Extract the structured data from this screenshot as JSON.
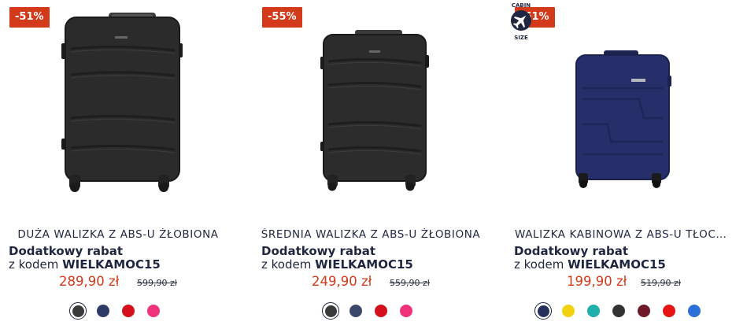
{
  "products": [
    {
      "badge": "-51%",
      "title": "DUŻA WALIZKA Z ABS-U ŻŁOBIONA",
      "promo_title": "Dodatkowy rabat",
      "promo_prefix": "z kodem",
      "promo_code": "WIELKAMOC15",
      "price": "289,90 zł",
      "old_price": "599,90 zł",
      "image": "black-large-hardshell-suitcase",
      "swatches": [
        "#3a3a3a",
        "#2e3a66",
        "#d4101a",
        "#f0327a"
      ]
    },
    {
      "badge": "-55%",
      "title": "ŚREDNIA WALIZKA Z ABS-U ŻŁOBIONA",
      "promo_title": "Dodatkowy rabat",
      "promo_prefix": "z kodem",
      "promo_code": "WIELKAMOC15",
      "price": "249,90 zł",
      "old_price": "559,90 zł",
      "image": "black-medium-hardshell-suitcase",
      "swatches": [
        "#3a3a3a",
        "#3b4768",
        "#d4101a",
        "#f0327a"
      ]
    },
    {
      "badge": "-61%",
      "cabin_label_top": "CABIN",
      "cabin_label_bottom": "SIZE",
      "title": "WALIZKA KABINOWA Z ABS-U TŁOCZO...",
      "promo_title": "Dodatkowy rabat",
      "promo_prefix": "z kodem",
      "promo_code": "WIELKAMOC15",
      "price": "199,90 zł",
      "old_price": "519,90 zł",
      "image": "navy-cabin-hardshell-suitcase",
      "swatches": [
        "#26305c",
        "#f2d20e",
        "#1fb0ac",
        "#333333",
        "#6e1a2b",
        "#e81313",
        "#2c6fd8"
      ]
    }
  ],
  "colors": {
    "accent": "#d33a1a",
    "text": "#1f2740",
    "suitcase_black": "#2b2b2b",
    "suitcase_navy": "#262f6a"
  }
}
